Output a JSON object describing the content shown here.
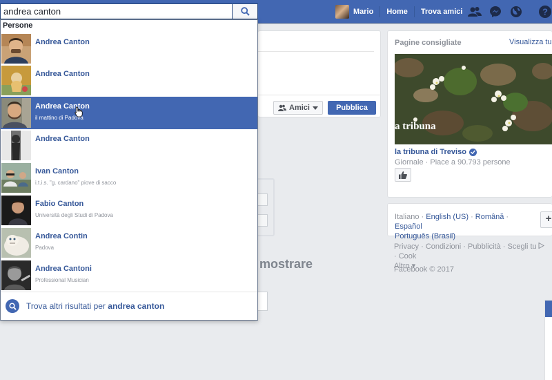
{
  "search": {
    "value": "andrea canton"
  },
  "nav": {
    "profile_name": "Mario",
    "home": "Home",
    "find_friends": "Trova amici"
  },
  "icons": [
    "search-icon",
    "friends-icon",
    "messenger-icon",
    "globe-icon",
    "help-icon",
    "search-icon"
  ],
  "dropdown": {
    "section_label": "Persone",
    "results": [
      {
        "name": "Andrea Canton",
        "subtitle": ""
      },
      {
        "name": "Andrea Canton",
        "subtitle": ""
      },
      {
        "name": "Andrea Canton",
        "subtitle": "il mattino di Padova",
        "highlighted": true
      },
      {
        "name": "Andrea Canton",
        "subtitle": ""
      },
      {
        "name": "Ivan Canton",
        "subtitle": "i.t.i.s. \"g. cardano\" piove di sacco"
      },
      {
        "name": "Fabio Canton",
        "subtitle": "Università degli Studi di Padova"
      },
      {
        "name": "Andrea Contin",
        "subtitle": "Padova"
      },
      {
        "name": "Andrea Cantoni",
        "subtitle": "Professional Musician"
      }
    ],
    "more_prefix": "Trova altri risultati per ",
    "more_query": "andrea canton"
  },
  "composer": {
    "audience_label": "Amici",
    "publish_label": "Pubblica"
  },
  "background": {
    "partial_text": "mostrare"
  },
  "suggested_pages": {
    "title": "Pagine consigliate",
    "view_all": "Visualizza tu",
    "image_caption": "a tribuna",
    "page_name": "la tribuna di Treviso",
    "page_meta": "Giornale · Piace a 90.793 persone"
  },
  "languages": {
    "current": "Italiano",
    "links": [
      "English (US)",
      "Română",
      "Español",
      "Português (Brasil)"
    ],
    "sep": " · "
  },
  "footer": {
    "links": [
      "Privacy",
      "Condizioni",
      "Pubblicità",
      "Scegli tu",
      "Cook",
      "Altro ▾"
    ],
    "copyright": "Facebook © 2017"
  },
  "colors": {
    "brand": "#4267b2",
    "link": "#365899",
    "muted": "#90949c",
    "page_bg": "#e9ebee"
  }
}
